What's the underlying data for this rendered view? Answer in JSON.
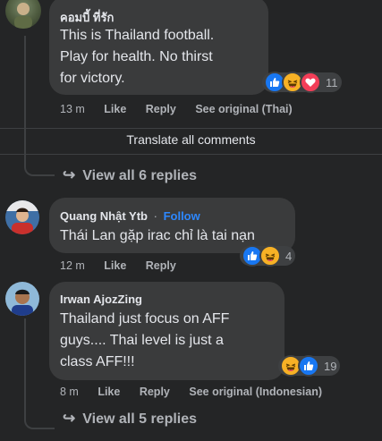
{
  "comments": [
    {
      "author": "คอมบี้ ที่รัก",
      "text_lines": [
        "This is Thailand football.",
        "Play for health. No thirst",
        "for victory."
      ],
      "time": "13 m",
      "like_label": "Like",
      "reply_label": "Reply",
      "see_original": "See original (Thai)",
      "reaction_count": "11",
      "reactions": [
        "like-icon",
        "haha-icon",
        "love-icon"
      ]
    },
    {
      "author": "Quang Nhật Ytb",
      "follow_label": "Follow",
      "follow_separator": "·",
      "text_lines": [
        "Thái Lan gặp irac chỉ là tai nạn"
      ],
      "time": "12 m",
      "like_label": "Like",
      "reply_label": "Reply",
      "reaction_count": "4",
      "reactions": [
        "like-icon",
        "haha-icon"
      ]
    },
    {
      "author": "Irwan AjozZing",
      "text_lines": [
        "Thailand just focus on AFF",
        "guys.... Thai level is just a",
        "class AFF!!!"
      ],
      "time": "8 m",
      "like_label": "Like",
      "reply_label": "Reply",
      "see_original": "See original (Indonesian)",
      "reaction_count": "19",
      "reactions": [
        "haha-icon",
        "like-icon"
      ]
    }
  ],
  "translate_all": "Translate all comments",
  "view_replies_1": "View all 6 replies",
  "view_replies_2": "View all 5 replies",
  "colors": {
    "background": "#242526",
    "bubble": "#3a3b3c",
    "follow": "#2d88ff",
    "like": "#1877f2",
    "haha": "#f7b125",
    "love": "#f33e58"
  }
}
